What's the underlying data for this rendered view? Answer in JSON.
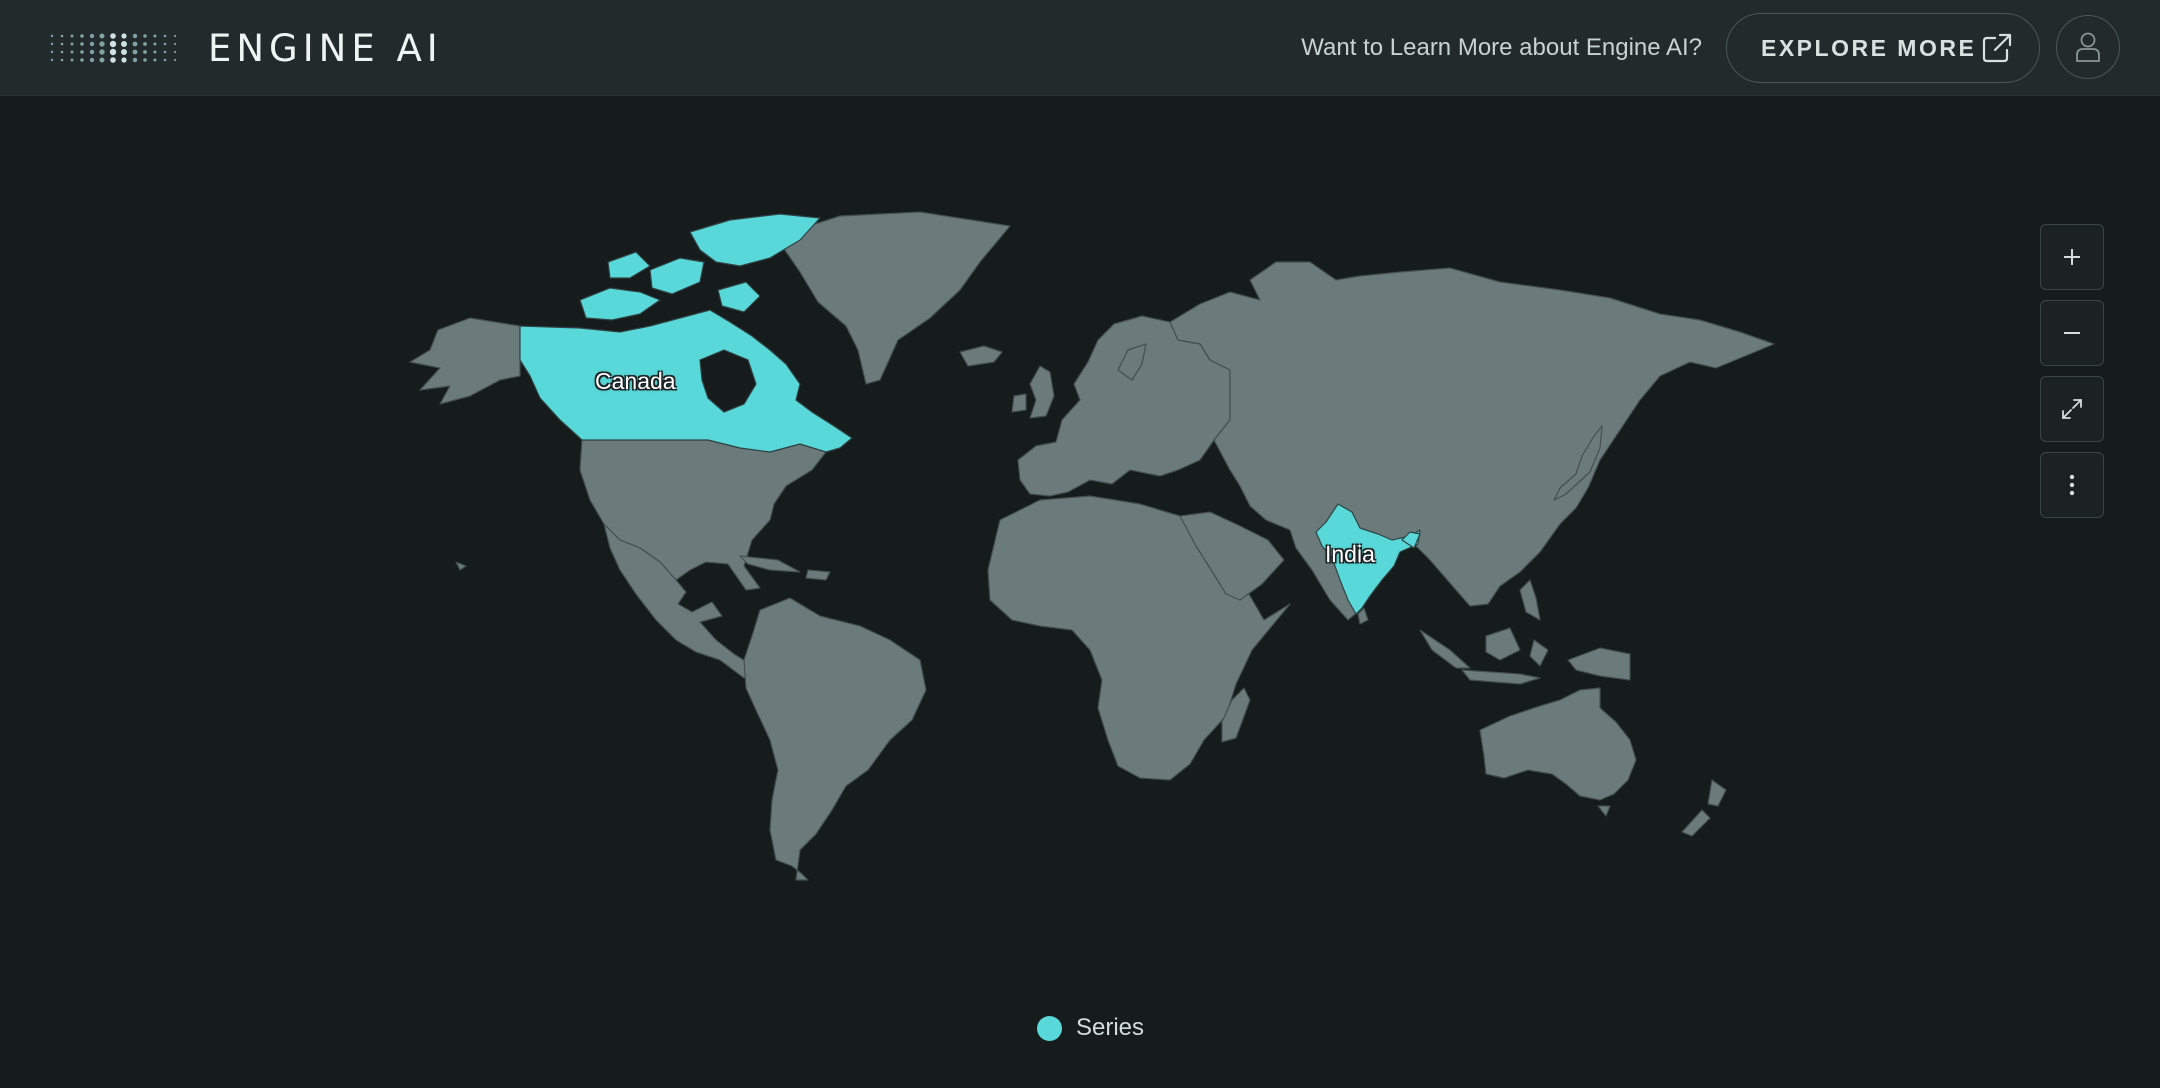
{
  "header": {
    "brand": "ENGINE AI",
    "promo_text": "Want to Learn More about Engine AI?",
    "explore_label": "EXPLORE MORE",
    "explore_icon": "external-link-icon",
    "user_icon": "user-icon"
  },
  "map": {
    "highlighted_countries": [
      {
        "name": "Canada"
      },
      {
        "name": "India"
      }
    ],
    "highlight_color": "#58d8d8",
    "land_color": "#6b7b7b",
    "background_color": "#161b1c",
    "legend": {
      "label": "Series"
    }
  },
  "map_controls": {
    "zoom_in": "plus-icon",
    "zoom_out": "minus-icon",
    "fullscreen": "expand-icon",
    "menu": "more-vertical-icon"
  }
}
